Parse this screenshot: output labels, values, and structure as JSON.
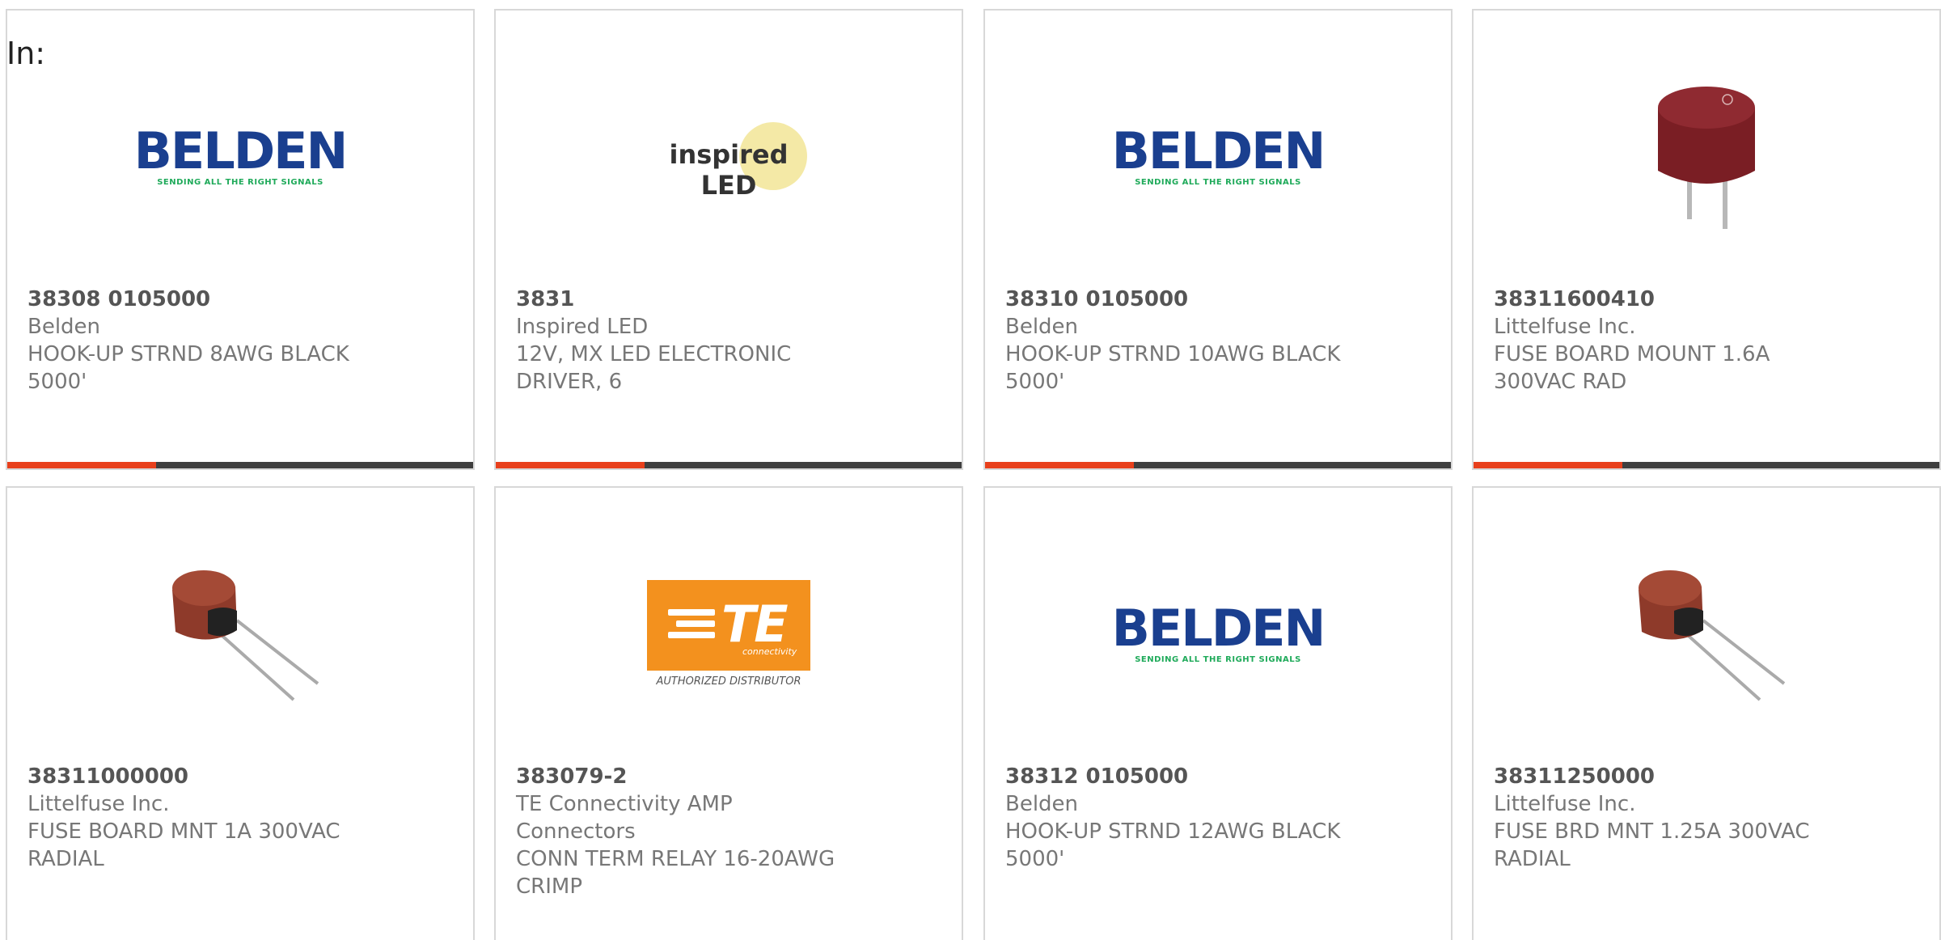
{
  "header": {
    "in_label": "In:"
  },
  "colors": {
    "accent_bar": "#e8401c",
    "bar_dark": "#3f3f3f",
    "belden_blue": "#1a3f8f",
    "belden_green": "#1faa5a",
    "te_orange": "#f3911e",
    "led_yellow": "#f4e9a6",
    "fuse_maroon": "#7a1e24",
    "fuse_brown": "#8e3a2a"
  },
  "logos": {
    "belden": {
      "word": "BELDEN",
      "tagline": "SENDING ALL THE RIGHT SIGNALS"
    },
    "inspired_led": {
      "text": "inspired LED"
    },
    "te": {
      "word": "TE",
      "sub": "connectivity",
      "authorized": "AUTHORIZED DISTRIBUTOR"
    }
  },
  "products": [
    {
      "part": "38308 0105000",
      "manufacturer": "Belden",
      "description": [
        "HOOK-UP STRND 8AWG BLACK",
        "5000'"
      ],
      "image": "belden-logo"
    },
    {
      "part": "3831",
      "manufacturer": "Inspired LED",
      "description": [
        "12V, MX LED ELECTRONIC",
        "DRIVER, 6"
      ],
      "image": "inspired-led-logo"
    },
    {
      "part": "38310 0105000",
      "manufacturer": "Belden",
      "description": [
        "HOOK-UP STRND 10AWG BLACK",
        "5000'"
      ],
      "image": "belden-logo"
    },
    {
      "part": "38311600410",
      "manufacturer": "Littelfuse Inc.",
      "description": [
        "FUSE BOARD MOUNT 1.6A",
        "300VAC RAD"
      ],
      "image": "fuse-upright-photo"
    },
    {
      "part": "38311000000",
      "manufacturer": "Littelfuse Inc.",
      "description": [
        "FUSE BOARD MNT 1A 300VAC",
        "RADIAL"
      ],
      "image": "fuse-tilted-photo"
    },
    {
      "part": "383079-2",
      "manufacturer": "TE Connectivity AMP Connectors",
      "description": [
        "CONN TERM RELAY 16-20AWG",
        "CRIMP"
      ],
      "image": "te-logo"
    },
    {
      "part": "38312 0105000",
      "manufacturer": "Belden",
      "description": [
        "HOOK-UP STRND 12AWG BLACK",
        "5000'"
      ],
      "image": "belden-logo"
    },
    {
      "part": "38311250000",
      "manufacturer": "Littelfuse Inc.",
      "description": [
        "FUSE BRD MNT 1.25A 300VAC",
        "RADIAL"
      ],
      "image": "fuse-tilted-photo"
    }
  ]
}
